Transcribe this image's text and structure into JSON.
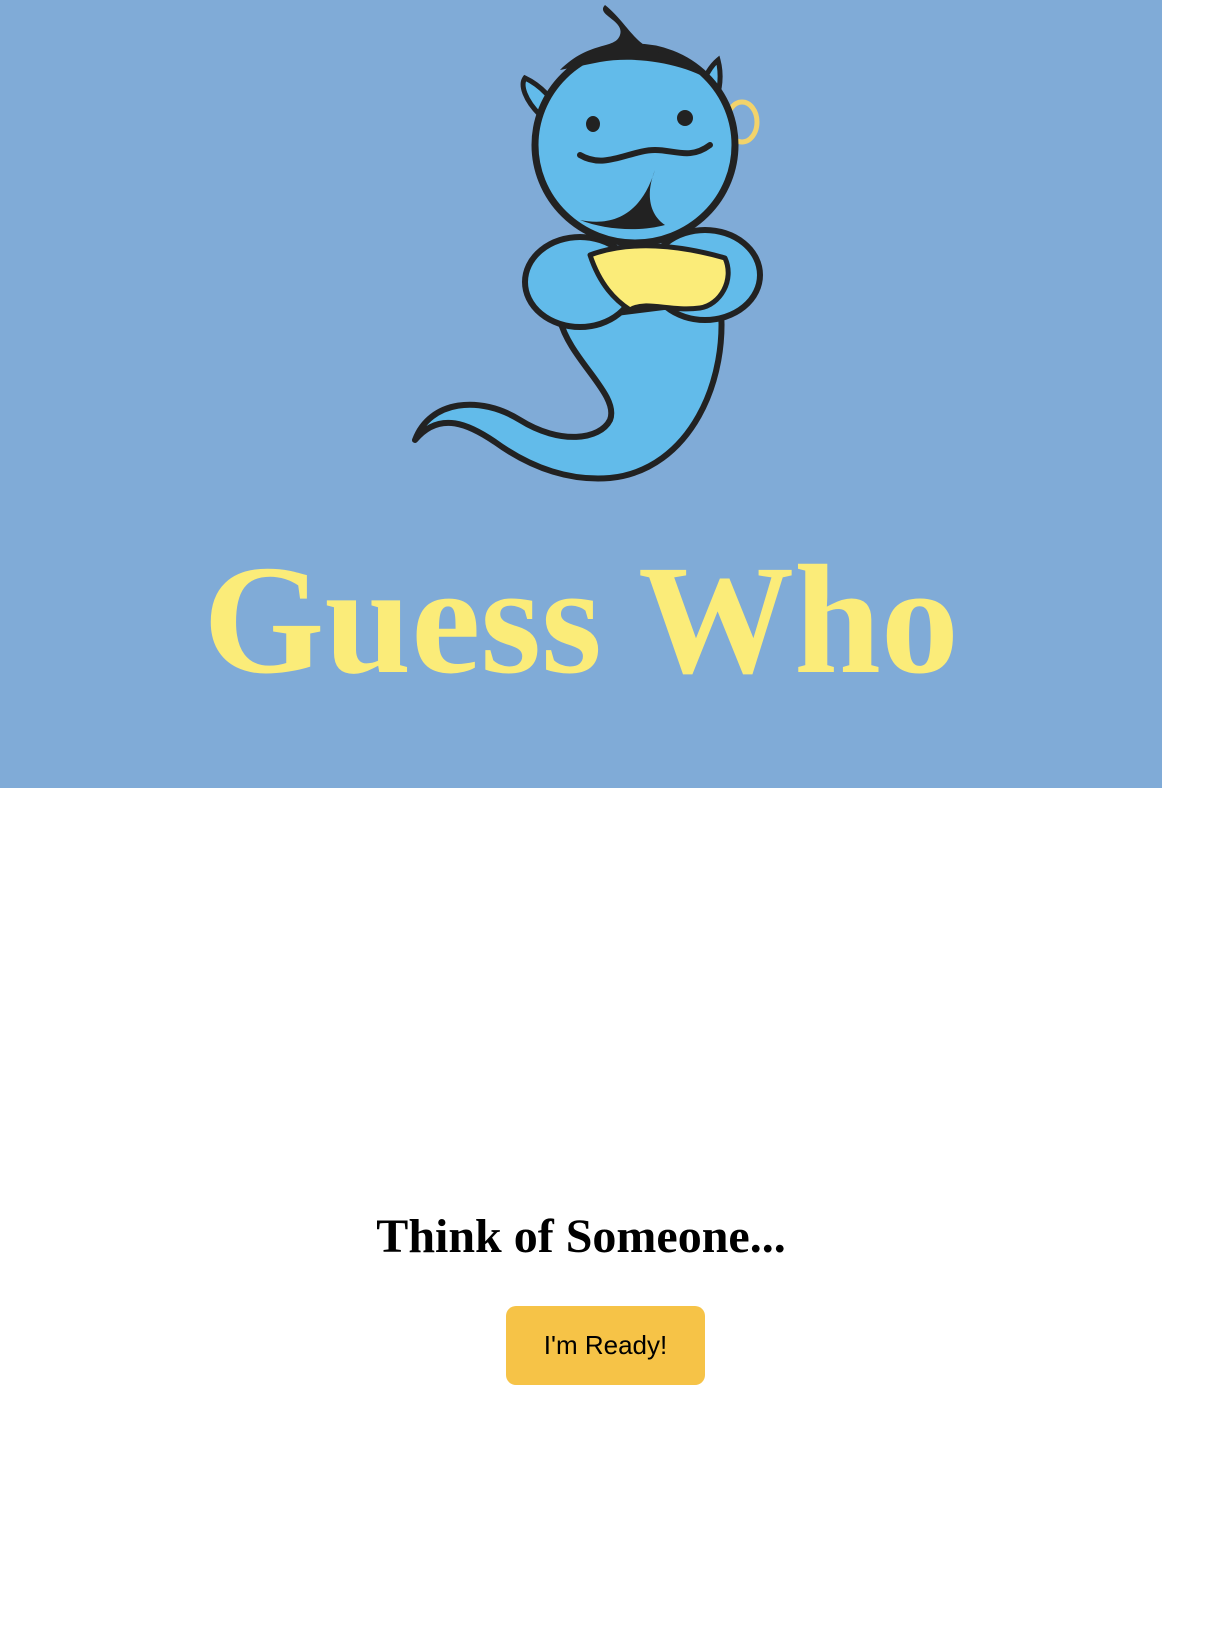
{
  "app": {
    "title": "Guess Who"
  },
  "hero": {
    "mascot_icon": "genie-mascot-icon",
    "background_color": "#80abd7",
    "title_color": "#fbec79"
  },
  "main": {
    "prompt": "Think of Someone...",
    "ready_button_label": "I'm Ready!",
    "button_color": "#f6c347"
  }
}
